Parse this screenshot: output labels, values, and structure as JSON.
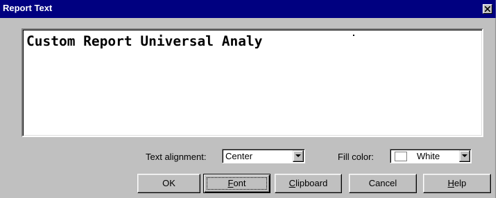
{
  "window": {
    "title": "Report Text",
    "close_icon": "close-icon"
  },
  "editor": {
    "text": "Custom Report Universal Analy"
  },
  "alignment": {
    "label": "Text alignment:",
    "value": "Center"
  },
  "fill": {
    "label": "Fill color:",
    "value": "White",
    "swatch_color": "#ffffff"
  },
  "buttons": {
    "ok": "OK",
    "font": {
      "mnemonic": "F",
      "rest": "ont"
    },
    "clipboard": {
      "mnemonic": "C",
      "rest": "lipboard"
    },
    "cancel": "Cancel",
    "help": {
      "mnemonic": "H",
      "rest": "elp"
    }
  },
  "colors": {
    "titlebar": "#000080",
    "face": "#c0c0c0"
  }
}
